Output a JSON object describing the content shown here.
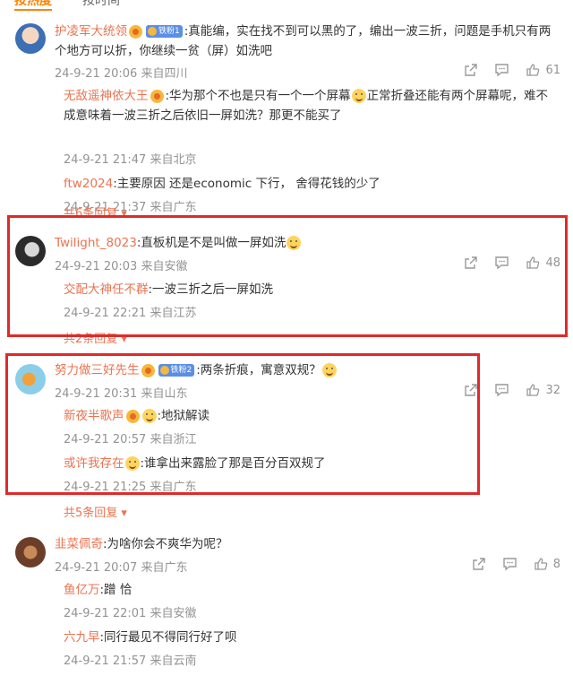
{
  "tabs": {
    "hot": "按热度",
    "time": "按时间"
  },
  "comments": [
    {
      "user": "护凌军大统领",
      "badge": "铁粉1",
      "text": ":真能编，实在找不到可以黑的了，编出一波三折，问题是手机只有两个地方可以折，你继续一贫（屏）如洗吧",
      "time": "24-9-21 20:06 来自四川",
      "likes": "61",
      "replies": [
        {
          "user": "无敌遥神依大王",
          "text": ":华为那个不也是只有一个一个屏幕",
          "text2": "正常折叠还能有两个屏幕呢，难不成意味着一波三折之后依旧一屏如洗？那更不能买了",
          "time": "24-9-21 21:47 来自北京"
        },
        {
          "user": "ftw2024",
          "text": ":主要原因 还是economic 下行， 舍得花钱的少了",
          "time": "24-9-21 21:37 来自广东"
        }
      ],
      "more": "共6条回复"
    },
    {
      "user": "Twilight_8023",
      "text": ":直板机是不是叫做一屏如洗",
      "time": "24-9-21 20:03 来自安徽",
      "likes": "48",
      "replies": [
        {
          "user": "交配大神任不群",
          "text": ":一波三折之后一屏如洗",
          "time": "24-9-21 22:21 来自江苏"
        }
      ],
      "more": "共2条回复"
    },
    {
      "user": "努力做三好先生",
      "badge": "铁粉2",
      "text": ":两条折痕，寓意双规？",
      "time": "24-9-21 20:31 来自山东",
      "likes": "32",
      "replies": [
        {
          "user": "新夜半歌声",
          "text": ":地狱解读",
          "time": "24-9-21 20:57 来自浙江"
        },
        {
          "user": "或许我存在",
          "text": ":谁拿出来露脸了那是百分百双规了",
          "time": "24-9-21 21:25 来自广东"
        }
      ],
      "more": "共5条回复"
    },
    {
      "user": "韭菜佩奇",
      "text": ":为啥你会不爽华为呢？",
      "time": "24-9-21 20:07 来自广东",
      "likes": "8",
      "replies": [
        {
          "user": "鱼亿万",
          "text": ":蹭 恰",
          "time": "24-9-21 22:01 来自安徽"
        },
        {
          "user": "六九早",
          "text": ":同行最见不得同行好了呗",
          "time": "24-9-21 21:57 来自云南"
        }
      ]
    }
  ]
}
